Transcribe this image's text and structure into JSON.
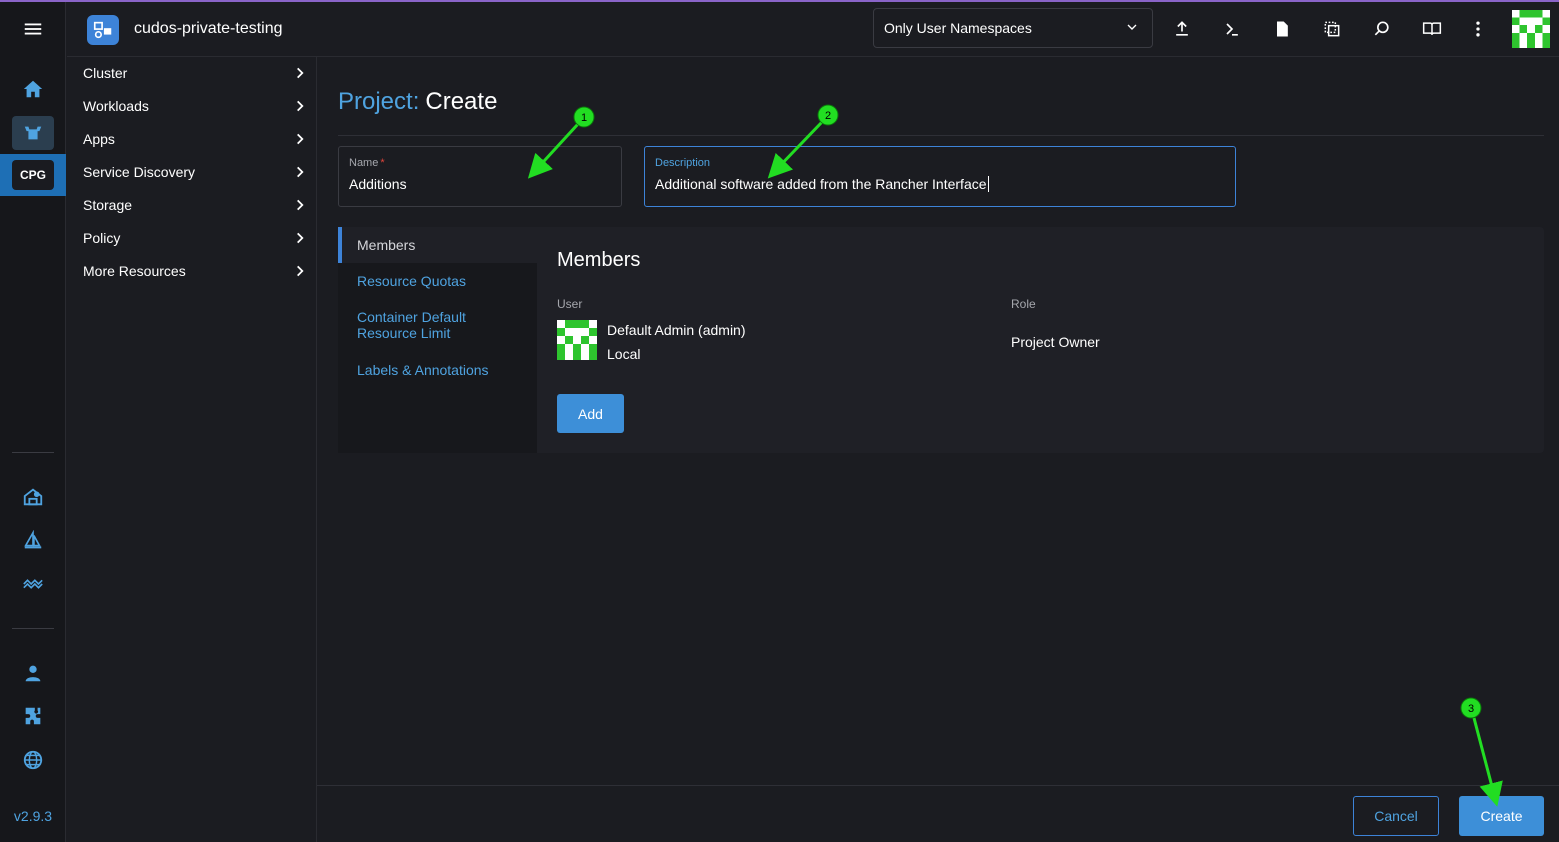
{
  "app": {
    "cluster_name": "cudos-private-testing",
    "version": "v2.9.3",
    "cluster_badge": "CPG"
  },
  "header": {
    "namespace_filter": "Only User Namespaces"
  },
  "sidenav": {
    "items": [
      {
        "label": "Cluster"
      },
      {
        "label": "Workloads"
      },
      {
        "label": "Apps"
      },
      {
        "label": "Service Discovery"
      },
      {
        "label": "Storage"
      },
      {
        "label": "Policy"
      },
      {
        "label": "More Resources"
      }
    ]
  },
  "page": {
    "title_prefix": "Project:",
    "title_action": "Create"
  },
  "form": {
    "name_label": "Name",
    "name_required": "*",
    "name_value": "Additions",
    "description_label": "Description",
    "description_value": "Additional software added from the Rancher Interface"
  },
  "tabs": [
    {
      "label": "Members"
    },
    {
      "label": "Resource Quotas"
    },
    {
      "label": "Container Default Resource Limit"
    },
    {
      "label": "Labels & Annotations"
    }
  ],
  "members": {
    "heading": "Members",
    "col_user": "User",
    "col_role": "Role",
    "user_name": "Default Admin (admin)",
    "user_provider": "Local",
    "role": "Project Owner",
    "add_label": "Add"
  },
  "footer": {
    "cancel_label": "Cancel",
    "create_label": "Create"
  },
  "annotations": [
    "1",
    "2",
    "3"
  ],
  "colors": {
    "accent": "#3d8fd8",
    "link": "#4fa3e0",
    "annotation": "#22dd22",
    "top_line": "#8a64c8"
  }
}
